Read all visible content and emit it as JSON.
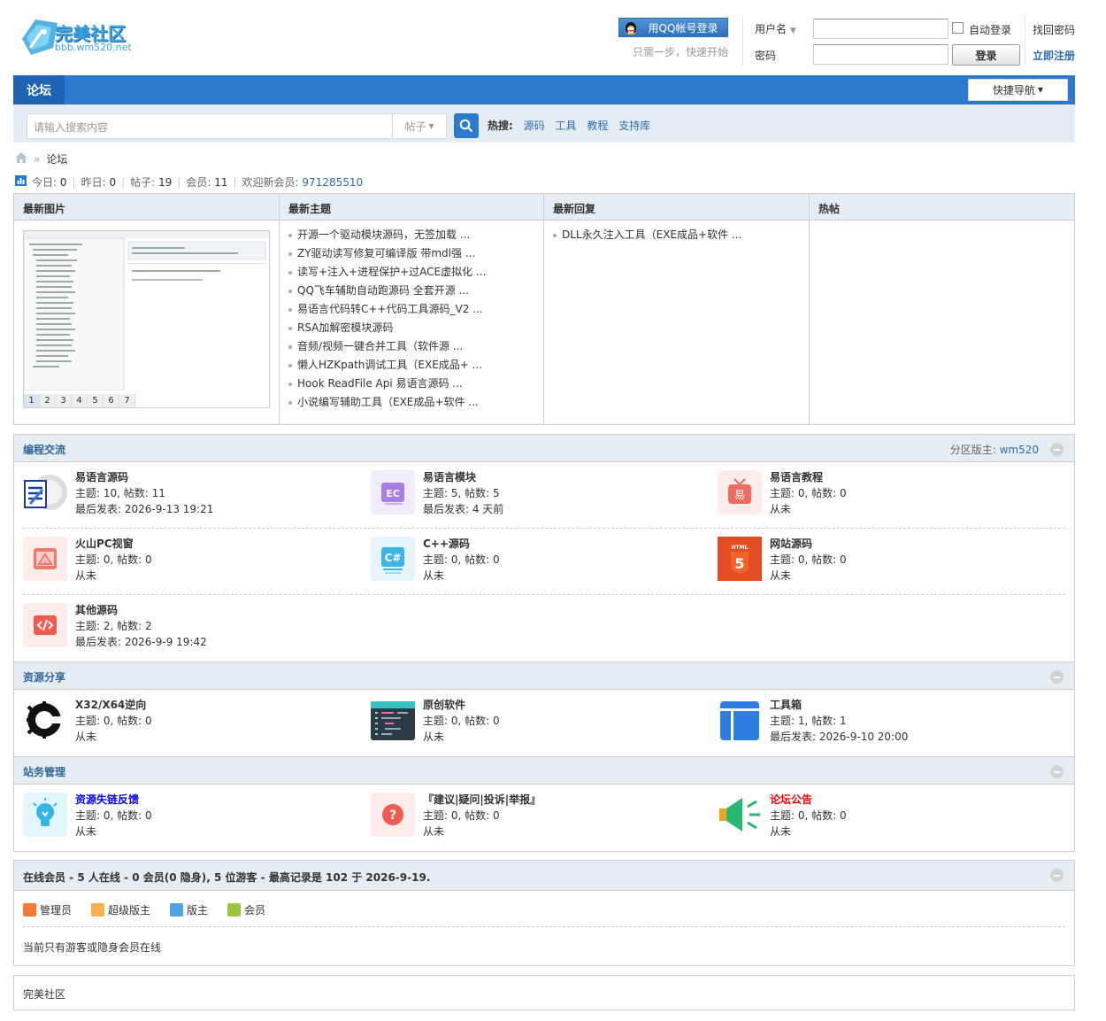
{
  "header": {
    "logo_text": "完美社区",
    "logo_subtext": "bbb.wm520.net",
    "qq_login": "用QQ帐号登录",
    "qq_hint": "只需一步，快速开始",
    "username_label": "用户名",
    "password_label": "密码",
    "auto_login": "自动登录",
    "login_button": "登录",
    "find_password": "找回密码",
    "register": "立即注册"
  },
  "nav": {
    "tab": "论坛",
    "quick_nav": "快捷导航"
  },
  "search": {
    "placeholder": "请输入搜索内容",
    "type": "帖子",
    "hot_label": "热搜:",
    "hot_items": [
      "源码",
      "工具",
      "教程",
      "支持库"
    ]
  },
  "breadcrumb": {
    "current": "论坛"
  },
  "stats": {
    "today_label": "今日:",
    "today": "0",
    "yesterday_label": "昨日:",
    "yesterday": "0",
    "posts_label": "帖子:",
    "posts": "19",
    "members_label": "会员:",
    "members": "11",
    "newest_label": "欢迎新会员:",
    "newest": "971285510"
  },
  "portal": {
    "col1_title": "最新图片",
    "col2_title": "最新主题",
    "col3_title": "最新回复",
    "col4_title": "热帖",
    "image_pages": [
      "1",
      "2",
      "3",
      "4",
      "5",
      "6",
      "7"
    ],
    "latest_topics": [
      "开源一个驱动模块源码，无签加载 ...",
      "ZY驱动读写修复可编译版 带mdl强 ...",
      "读写+注入+进程保护+过ACE虚拟化 ...",
      "QQ飞车辅助自动跑源码 全套开源 ...",
      "易语言代码转C++代码工具源码_V2 ...",
      "RSA加解密模块源码",
      "音频/视频一键合并工具（软件源 ...",
      "懒人HZKpath调试工具（EXE成品+ ...",
      "Hook ReadFile Api 易语言源码 ...",
      "小说编写辅助工具（EXE成品+软件 ..."
    ],
    "latest_replies": [
      "DLL永久注入工具（EXE成品+软件 ..."
    ]
  },
  "groups": [
    {
      "title": "编程交流",
      "moderator_label": "分区版主:",
      "moderator": "wm520",
      "forums": [
        {
          "name": "易语言源码",
          "stats": "主题: 10, 帖数: 11",
          "last": "最后发表: 2026-9-13 19:21",
          "icon": "e-lang-source-icon"
        },
        {
          "name": "易语言模块",
          "stats": "主题: 5, 帖数: 5",
          "last": "最后发表: 4 天前",
          "icon": "ec-module-icon"
        },
        {
          "name": "易语言教程",
          "stats": "主题: 0, 帖数: 0",
          "last": "从未",
          "icon": "tutorial-tv-icon"
        },
        {
          "name": "火山PC视窗",
          "stats": "主题: 0, 帖数: 0",
          "last": "从未",
          "icon": "volcano-pc-icon"
        },
        {
          "name": "C++源码",
          "stats": "主题: 0, 帖数: 0",
          "last": "从未",
          "icon": "csharp-icon"
        },
        {
          "name": "网站源码",
          "stats": "主题: 0, 帖数: 0",
          "last": "从未",
          "icon": "html5-icon"
        },
        {
          "name": "其他源码",
          "stats": "主题: 2, 帖数: 2",
          "last": "最后发表: 2026-9-9 19:42",
          "icon": "code-icon"
        }
      ]
    },
    {
      "title": "资源分享",
      "forums": [
        {
          "name": "X32/X64逆向",
          "stats": "主题: 0, 帖数: 0",
          "last": "从未",
          "icon": "cheat-engine-icon"
        },
        {
          "name": "原创软件",
          "stats": "主题: 0, 帖数: 0",
          "last": "从未",
          "icon": "editor-icon"
        },
        {
          "name": "工具箱",
          "stats": "主题: 1, 帖数: 1",
          "last": "最后发表: 2026-9-10 20:00",
          "icon": "toolbox-icon"
        }
      ]
    },
    {
      "title": "站务管理",
      "forums": [
        {
          "name": "资源失链反馈",
          "stats": "主题: 0, 帖数: 0",
          "last": "从未",
          "icon": "lightbulb-icon",
          "color": "#0000ff"
        },
        {
          "name": "『建议|疑问|投诉|举报』",
          "stats": "主题: 0, 帖数: 0",
          "last": "从未",
          "icon": "question-icon"
        },
        {
          "name": "论坛公告",
          "stats": "主题: 0, 帖数: 0",
          "last": "从未",
          "icon": "megaphone-icon",
          "color": "#ff0000"
        }
      ]
    }
  ],
  "online": {
    "title": "在线会员 - 5 人在线 - 0 会员(0 隐身), 5 位游客 - 最高记录是 102 于 2026-9-19.",
    "legend": [
      "管理员",
      "超级版主",
      "版主",
      "会员"
    ],
    "message": "当前只有游客或隐身会员在线"
  },
  "footer": {
    "text": "完美社区"
  },
  "colors": {
    "accent": "#2b7acd",
    "link": "#2b6cb0",
    "header_bg": "#e5edf2"
  }
}
